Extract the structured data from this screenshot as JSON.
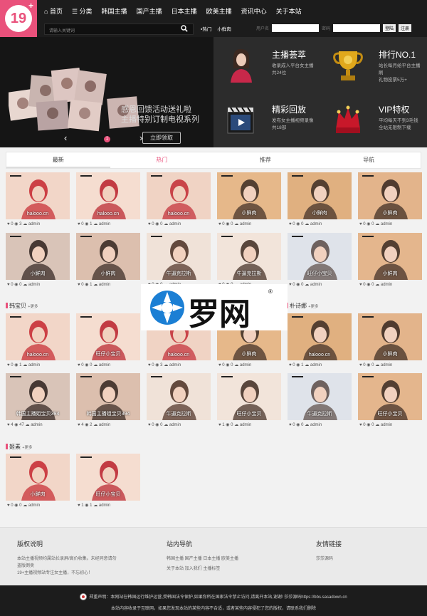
{
  "logo": {
    "text": "19",
    "plus": "+"
  },
  "nav": [
    "首页",
    "分类",
    "韩国主播",
    "国产主播",
    "日本主播",
    "欧美主播",
    "资讯中心",
    "关于本站"
  ],
  "search": {
    "placeholder": "请输入关键词"
  },
  "hot_links": [
    "热门",
    "小鲜肉"
  ],
  "login": {
    "user_label": "用户名",
    "pass_label": "密码",
    "login_btn": "登陆",
    "register_btn": "注册"
  },
  "banner": {
    "promo_line1": "感恩回馈活动送礼啦",
    "promo_line2": "主播特别订制电视系列",
    "promo_button": "立即领取",
    "prev": "‹",
    "next": "›",
    "page": "1"
  },
  "features": [
    {
      "title": "主播荟萃",
      "desc": "收录成人平台女主播",
      "count": "共24位"
    },
    {
      "title": "排行NO.1",
      "desc": "站长每月给平台主播刷",
      "count": "礼物投票5万+"
    },
    {
      "title": "精彩回放",
      "desc": "发布女主播视频录像",
      "count": "共18部"
    },
    {
      "title": "VIP特权",
      "desc": "平均每天不到3毛钱",
      "count": "全站无限制下载"
    }
  ],
  "tabs": [
    "最新",
    "热门",
    "推荐",
    "导航"
  ],
  "sections": [
    {
      "name": "韩宝贝",
      "more": "+更多"
    },
    {
      "name": "朴诗娜",
      "more": "+更多"
    },
    {
      "name": "姬素",
      "more": "+更多"
    }
  ],
  "cards": [
    {
      "caption": "halooo.cn",
      "likes": "0",
      "views": "3",
      "author": "admin"
    },
    {
      "caption": "halooo.cn",
      "likes": "0",
      "views": "1",
      "author": "admin"
    },
    {
      "caption": "halooo.cn",
      "likes": "0",
      "views": "0",
      "author": "admin"
    },
    {
      "caption": "小鲜肉",
      "likes": "0",
      "views": "0",
      "author": "admin"
    },
    {
      "caption": "小鲜肉",
      "likes": "0",
      "views": "0",
      "author": "admin"
    },
    {
      "caption": "小鲜肉",
      "likes": "0",
      "views": "0",
      "author": "admin"
    },
    {
      "caption": "小鲜肉",
      "likes": "0",
      "views": "0",
      "author": "admin"
    },
    {
      "caption": "小鲜肉",
      "likes": "0",
      "views": "1",
      "author": "admin"
    },
    {
      "caption": "牛逼克拉斯",
      "likes": "0",
      "views": "0",
      "author": "admin"
    },
    {
      "caption": "牛逼克拉斯",
      "likes": "0",
      "views": "0",
      "author": "admin"
    },
    {
      "caption": "旺仔小宝贝",
      "likes": "0",
      "views": "0",
      "author": "admin"
    },
    {
      "caption": "小鲜肉",
      "likes": "0",
      "views": "0",
      "author": "admin"
    },
    {
      "caption": "halooo.cn",
      "likes": "0",
      "views": "1",
      "author": "admin"
    },
    {
      "caption": "旺仔小宝贝",
      "likes": "0",
      "views": "0",
      "author": "admin"
    },
    {
      "caption": "halooo.cn",
      "likes": "0",
      "views": "3",
      "author": "admin"
    },
    {
      "caption": "小鲜肉",
      "likes": "0",
      "views": "0",
      "author": "admin"
    },
    {
      "caption": "halooo.cn",
      "likes": "0",
      "views": "1",
      "author": "admin"
    },
    {
      "caption": "小鲜肉",
      "likes": "0",
      "views": "0",
      "author": "admin"
    },
    {
      "caption": "韩国主播姐宝贝394",
      "likes": "4",
      "views": "47",
      "author": "admin"
    },
    {
      "caption": "韩国主播姐宝贝394",
      "likes": "4",
      "views": "2",
      "author": "admin"
    },
    {
      "caption": "牛逼克拉斯",
      "likes": "0",
      "views": "0",
      "author": "admin"
    },
    {
      "caption": "旺仔小宝贝",
      "likes": "1",
      "views": "0",
      "author": "admin"
    },
    {
      "caption": "牛逼克拉斯",
      "likes": "0",
      "views": "0",
      "author": "admin"
    },
    {
      "caption": "旺仔小宝贝",
      "likes": "0",
      "views": "0",
      "author": "admin"
    },
    {
      "caption": "小鲜肉",
      "likes": "0",
      "views": "0",
      "author": "admin"
    },
    {
      "caption": "旺仔小宝贝",
      "likes": "1",
      "views": "1",
      "author": "admin"
    }
  ],
  "watermark": {
    "text": "罗网",
    "reg": "®"
  },
  "footer": {
    "col1_title": "版权说明",
    "col1_text": "本站主播视频均属站长录屏/高价收集。未经同意请勿盗版倒卖",
    "col1_text2": "19+主播视频站专注女主播，不忘初心！",
    "col2_title": "站内导航",
    "col2_links1": "韩国主播 国产主播 日本主播 欧美主播",
    "col2_links2": "关于本站 加入我们 主播标签",
    "col3_title": "友情链接",
    "col3_links": "莎莎源码",
    "notice": "郑重声明：本网站在韩国运行维护运营,受韩国法令保护,如果你所在国家法令禁止访问,请离开本站,谢谢! 莎莎源码https://bbs.sasadown.cn",
    "notice2": "本站内容收录于互联网，如果您发现本站的某些内容不合适，或者某些内容侵犯了您的版权，请联系我们删除"
  },
  "colors": {
    "accent": "#e9517b",
    "dark": "#1c1c1c"
  }
}
